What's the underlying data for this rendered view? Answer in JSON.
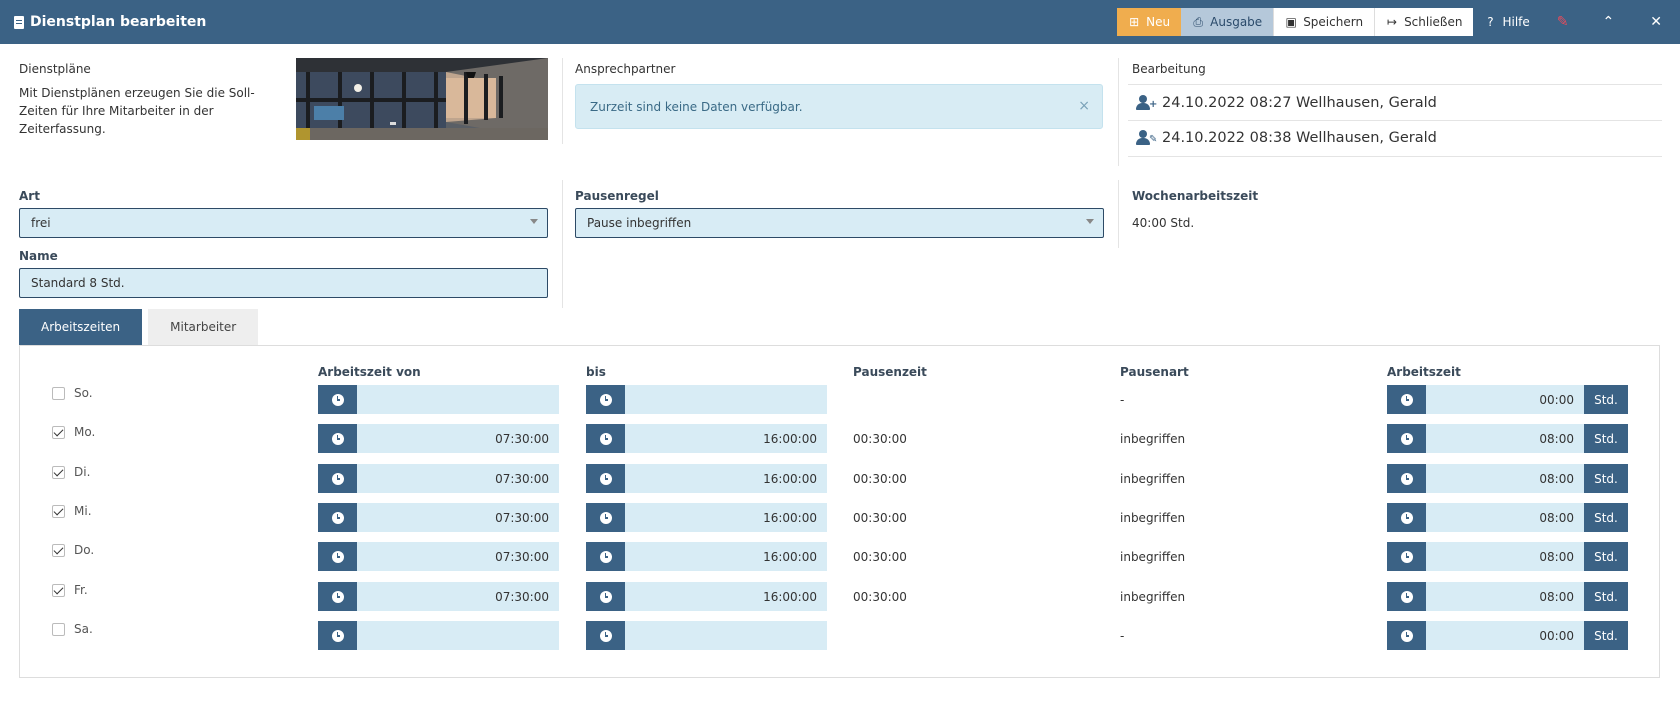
{
  "window": {
    "title": "Dienstplan bearbeiten"
  },
  "toolbar": {
    "neu": "Neu",
    "ausgabe": "Ausgabe",
    "speichern": "Speichern",
    "schliessen": "Schließen",
    "hilfe": "Hilfe"
  },
  "dienstplaene": {
    "label": "Dienstpläne",
    "text": "Mit Dienstplänen erzeugen Sie die Soll-Zeiten für Ihre Mitarbeiter in der Zeiterfassung."
  },
  "ansprechpartner": {
    "label": "Ansprechpartner",
    "empty": "Zurzeit sind keine Daten verfügbar.",
    "close": "×"
  },
  "bearbeitung": {
    "label": "Bearbeitung",
    "entries": [
      {
        "text": "24.10.2022 08:27 Wellhausen, Gerald",
        "icon": "user-plus-icon"
      },
      {
        "text": "24.10.2022 08:38 Wellhausen, Gerald",
        "icon": "user-edit-icon"
      }
    ]
  },
  "form": {
    "art_label": "Art",
    "art_value": "frei",
    "name_label": "Name",
    "name_value": "Standard 8 Std.",
    "pausenregel_label": "Pausenregel",
    "pausenregel_value": "Pause inbegriffen",
    "wochenarbeitszeit_label": "Wochenarbeitszeit",
    "wochenarbeitszeit_value": "40:00 Std."
  },
  "tabs": {
    "arbeitszeiten": "Arbeitszeiten",
    "mitarbeiter": "Mitarbeiter"
  },
  "table": {
    "headers": {
      "von": "Arbeitszeit von",
      "bis": "bis",
      "pausenzeit": "Pausenzeit",
      "pausenart": "Pausenart",
      "arbeitszeit": "Arbeitszeit"
    },
    "unit": "Std.",
    "rows": [
      {
        "day": "So.",
        "checked": false,
        "von": "",
        "bis": "",
        "pausenzeit": "",
        "pausenart": "-",
        "arbeitszeit": "00:00"
      },
      {
        "day": "Mo.",
        "checked": true,
        "von": "07:30:00",
        "bis": "16:00:00",
        "pausenzeit": "00:30:00",
        "pausenart": "inbegriffen",
        "arbeitszeit": "08:00"
      },
      {
        "day": "Di.",
        "checked": true,
        "von": "07:30:00",
        "bis": "16:00:00",
        "pausenzeit": "00:30:00",
        "pausenart": "inbegriffen",
        "arbeitszeit": "08:00"
      },
      {
        "day": "Mi.",
        "checked": true,
        "von": "07:30:00",
        "bis": "16:00:00",
        "pausenzeit": "00:30:00",
        "pausenart": "inbegriffen",
        "arbeitszeit": "08:00"
      },
      {
        "day": "Do.",
        "checked": true,
        "von": "07:30:00",
        "bis": "16:00:00",
        "pausenzeit": "00:30:00",
        "pausenart": "inbegriffen",
        "arbeitszeit": "08:00"
      },
      {
        "day": "Fr.",
        "checked": true,
        "von": "07:30:00",
        "bis": "16:00:00",
        "pausenzeit": "00:30:00",
        "pausenart": "inbegriffen",
        "arbeitszeit": "08:00"
      },
      {
        "day": "Sa.",
        "checked": false,
        "von": "",
        "bis": "",
        "pausenzeit": "",
        "pausenart": "-",
        "arbeitszeit": "00:00"
      }
    ]
  },
  "colors": {
    "primary": "#3b6285",
    "accent": "#f0ad4e",
    "field": "#d8ecf5",
    "info": "#d8ecf4"
  }
}
